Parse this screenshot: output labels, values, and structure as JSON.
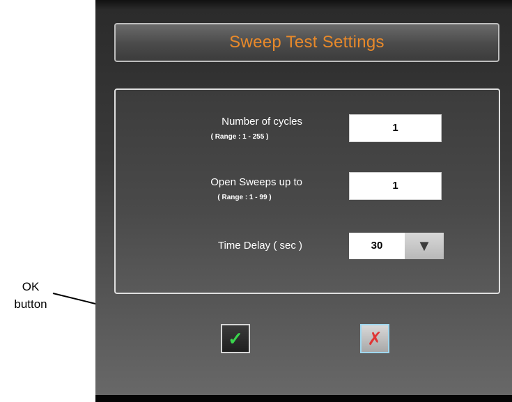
{
  "annotation": {
    "label_line1": "OK",
    "label_line2": "button"
  },
  "dialog": {
    "title": "Sweep Test Settings",
    "fields": [
      {
        "label": "Number of cycles",
        "range": "( Range : 1 - 255 )",
        "value": "1"
      },
      {
        "label": "Open Sweeps up to",
        "range": "( Range : 1 - 99 )",
        "value": "1"
      },
      {
        "label": "Time Delay ( sec )",
        "value": "30"
      }
    ],
    "buttons": {
      "ok_icon": "check-icon",
      "ok_glyph": "✓",
      "cancel_icon": "x-icon",
      "cancel_glyph": "✗",
      "dropdown_icon": "triangle-down-icon",
      "dropdown_glyph": "▼"
    }
  },
  "colors": {
    "title": "#e8892a",
    "ok_check": "#3ad54d",
    "cancel_x": "#e03535",
    "cancel_border": "#9fd7ef"
  }
}
